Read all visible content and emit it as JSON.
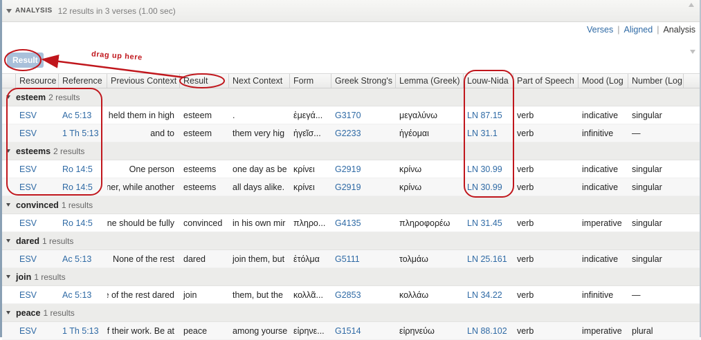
{
  "panel": {
    "title": "ANALYSIS",
    "status": "12 results in 3 verses (1.00 sec)"
  },
  "view_tabs": [
    {
      "label": "Verses",
      "active": false
    },
    {
      "label": "Aligned",
      "active": false
    },
    {
      "label": "Analysis",
      "active": true
    }
  ],
  "groupby_label": "Result",
  "annotation": {
    "drag_note": "drag up here",
    "color": "#c0161c"
  },
  "columns": [
    "Resource",
    "Reference",
    "Previous Context",
    "Result",
    "Next Context",
    "Form",
    "Greek Strong's",
    "Lemma (Greek)",
    "Louw-Nida",
    "Part of Speech",
    "Mood (Log",
    "Number (Log"
  ],
  "groups": [
    {
      "name": "esteem",
      "count": "2 results",
      "rows": [
        {
          "resource": "ESV",
          "reference": "Ac 5:13",
          "prev": "held them in high",
          "result": "esteem",
          "next": ".",
          "form": "ἐμεγά...",
          "strongs": "G3170",
          "lemma": "μεγαλύνω",
          "ln": "LN 87.15",
          "pos": "verb",
          "mood": "indicative",
          "number": "singular"
        },
        {
          "resource": "ESV",
          "reference": "1 Th 5:13",
          "prev": "and to",
          "result": "esteem",
          "next": "them very hig",
          "form": "ἡγεῖσ...",
          "strongs": "G2233",
          "lemma": "ἡγέομαι",
          "ln": "LN 31.1",
          "pos": "verb",
          "mood": "infinitive",
          "number": "—"
        }
      ]
    },
    {
      "name": "esteems",
      "count": "2 results",
      "rows": [
        {
          "resource": "ESV",
          "reference": "Ro 14:5",
          "prev": "One person",
          "result": "esteems",
          "next": "one day as be",
          "form": "κρίνει",
          "strongs": "G2919",
          "lemma": "κρίνω",
          "ln": "LN 30.99",
          "pos": "verb",
          "mood": "indicative",
          "number": "singular"
        },
        {
          "resource": "ESV",
          "reference": "Ro 14:5",
          "prev": "ner, while another",
          "result": "esteems",
          "next": "all days alike.",
          "form": "κρίνει",
          "strongs": "G2919",
          "lemma": "κρίνω",
          "ln": "LN 30.99",
          "pos": "verb",
          "mood": "indicative",
          "number": "singular"
        }
      ]
    },
    {
      "name": "convinced",
      "count": "1 results",
      "rows": [
        {
          "resource": "ESV",
          "reference": "Ro 14:5",
          "prev": "ne should be fully",
          "result": "convinced",
          "next": "in his own mir",
          "form": "πληρο...",
          "strongs": "G4135",
          "lemma": "πληροφορέω",
          "ln": "LN 31.45",
          "pos": "verb",
          "mood": "imperative",
          "number": "singular"
        }
      ]
    },
    {
      "name": "dared",
      "count": "1 results",
      "rows": [
        {
          "resource": "ESV",
          "reference": "Ac 5:13",
          "prev": "None of the rest",
          "result": "dared",
          "next": "join them, but",
          "form": "ἐτόλμα",
          "strongs": "G5111",
          "lemma": "τολμάω",
          "ln": "LN 25.161",
          "pos": "verb",
          "mood": "indicative",
          "number": "singular"
        }
      ]
    },
    {
      "name": "join",
      "count": "1 results",
      "rows": [
        {
          "resource": "ESV",
          "reference": "Ac 5:13",
          "prev": "e of the rest dared",
          "result": "join",
          "next": "them, but the",
          "form": "κολλᾶ...",
          "strongs": "G2853",
          "lemma": "κολλάω",
          "ln": "LN 34.22",
          "pos": "verb",
          "mood": "infinitive",
          "number": "—"
        }
      ]
    },
    {
      "name": "peace",
      "count": "1 results",
      "rows": [
        {
          "resource": "ESV",
          "reference": "1 Th 5:13",
          "prev": "f their work. Be at",
          "result": "peace",
          "next": "among yourse",
          "form": "εἰρηνε...",
          "strongs": "G1514",
          "lemma": "εἰρηνεύω",
          "ln": "LN 88.102",
          "pos": "verb",
          "mood": "imperative",
          "number": "plural"
        }
      ]
    }
  ]
}
